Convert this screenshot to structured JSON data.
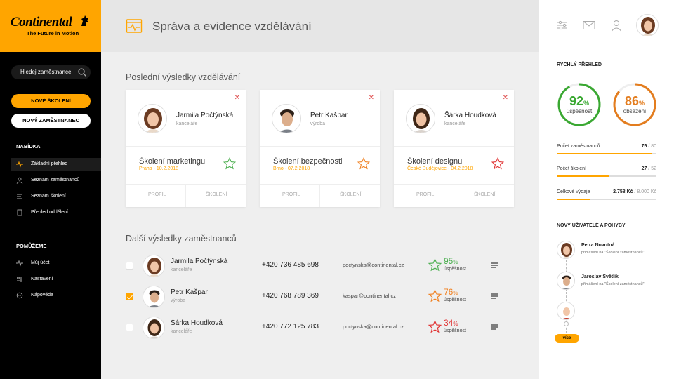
{
  "brand": {
    "name": "Continental",
    "tagline": "The Future in Motion",
    "accent": "#ffa500"
  },
  "sidebar": {
    "search_placeholder": "Hledej zaměstnance",
    "primary_button": "NOVÉ ŠKOLENÍ",
    "secondary_button": "NOVÝ ZAMĚSTNANEC",
    "menu_title": "NABÍDKA",
    "menu": [
      {
        "label": "Základní přehled",
        "icon": "pulse-icon",
        "active": true
      },
      {
        "label": "Seznam zaměstnanců",
        "icon": "user-icon",
        "active": false
      },
      {
        "label": "Seznam školení",
        "icon": "list-icon",
        "active": false
      },
      {
        "label": "Přehled oddělení",
        "icon": "doc-icon",
        "active": false
      }
    ],
    "help_title": "POMŮŽEME",
    "help": [
      {
        "label": "Můj účet",
        "icon": "pulse-icon"
      },
      {
        "label": "Nastavení",
        "icon": "sliders-icon"
      },
      {
        "label": "Nápověda",
        "icon": "chat-icon"
      }
    ]
  },
  "header": {
    "title": "Správa a evidence vzdělávání"
  },
  "recent": {
    "title": "Poslední výsledky vzdělávání",
    "cards": [
      {
        "name": "Jarmila Počtýnská",
        "dept": "kanceláře",
        "course": "Školení marketingu",
        "meta": "Praha - 10.2.2018",
        "star_color": "#4caf50",
        "profile": "PROFIL",
        "training": "ŠKOLENÍ"
      },
      {
        "name": "Petr Kašpar",
        "dept": "výroba",
        "course": "Školení bezpečnosti",
        "meta": "Brno - 07.2.2018",
        "star_color": "#f08020",
        "profile": "PROFIL",
        "training": "ŠKOLENÍ"
      },
      {
        "name": "Šárka Houdková",
        "dept": "kanceláře",
        "course": "Školení designu",
        "meta": "České Budějovice - 04.2.2018",
        "star_color": "#e03030",
        "profile": "PROFIL",
        "training": "ŠKOLENÍ"
      }
    ]
  },
  "others": {
    "title": "Další výsledky zaměstnanců",
    "rows": [
      {
        "name": "Jarmila Počtýnská",
        "dept": "kanceláře",
        "phone": "+420 736 485 698",
        "email": "poctynska@continental.cz",
        "pct": "95",
        "pct_suffix": "%",
        "label": "úspěšnost",
        "color": "#4caf50",
        "checked": false
      },
      {
        "name": "Petr Kašpar",
        "dept": "výroba",
        "phone": "+420 768 789 369",
        "email": "kaspar@continental.cz",
        "pct": "76",
        "pct_suffix": "%",
        "label": "úspěšnost",
        "color": "#f08020",
        "checked": true
      },
      {
        "name": "Šárka Houdková",
        "dept": "kanceláře",
        "phone": "+420 772 125 783",
        "email": "poctynska@continental.cz",
        "pct": "34",
        "pct_suffix": "%",
        "label": "úspěšnost",
        "color": "#e03030",
        "checked": false
      }
    ]
  },
  "overview": {
    "title": "RYCHLÝ PŘEHLED",
    "gauges": [
      {
        "value": "92",
        "suffix": "%",
        "label": "úspěšnost",
        "fraction": 0.92,
        "color": "#3aa832"
      },
      {
        "value": "86",
        "suffix": "%",
        "label": "obsazení",
        "fraction": 0.86,
        "color": "#e37d1f"
      }
    ],
    "stats": [
      {
        "label": "Počet zaměstnanců",
        "value": "76",
        "total": " / 80",
        "fraction": 0.95
      },
      {
        "label": "Počet školení",
        "value": "27",
        "total": " / 52",
        "fraction": 0.52
      },
      {
        "label": "Celkové výdaje",
        "value": "2.758 Kč",
        "total": " / 8.000 Kč",
        "fraction": 0.34
      }
    ]
  },
  "activity": {
    "title": "NOVÝ UŽIVATELÉ A POHYBY",
    "items": [
      {
        "name": "Petra Novotná",
        "desc": "přihlášení na \"Školení zaměstnanců\""
      },
      {
        "name": "Jaroslav Světlík",
        "desc": "přihlášení na \"Školení zaměstnanců\""
      }
    ],
    "more": "více"
  }
}
